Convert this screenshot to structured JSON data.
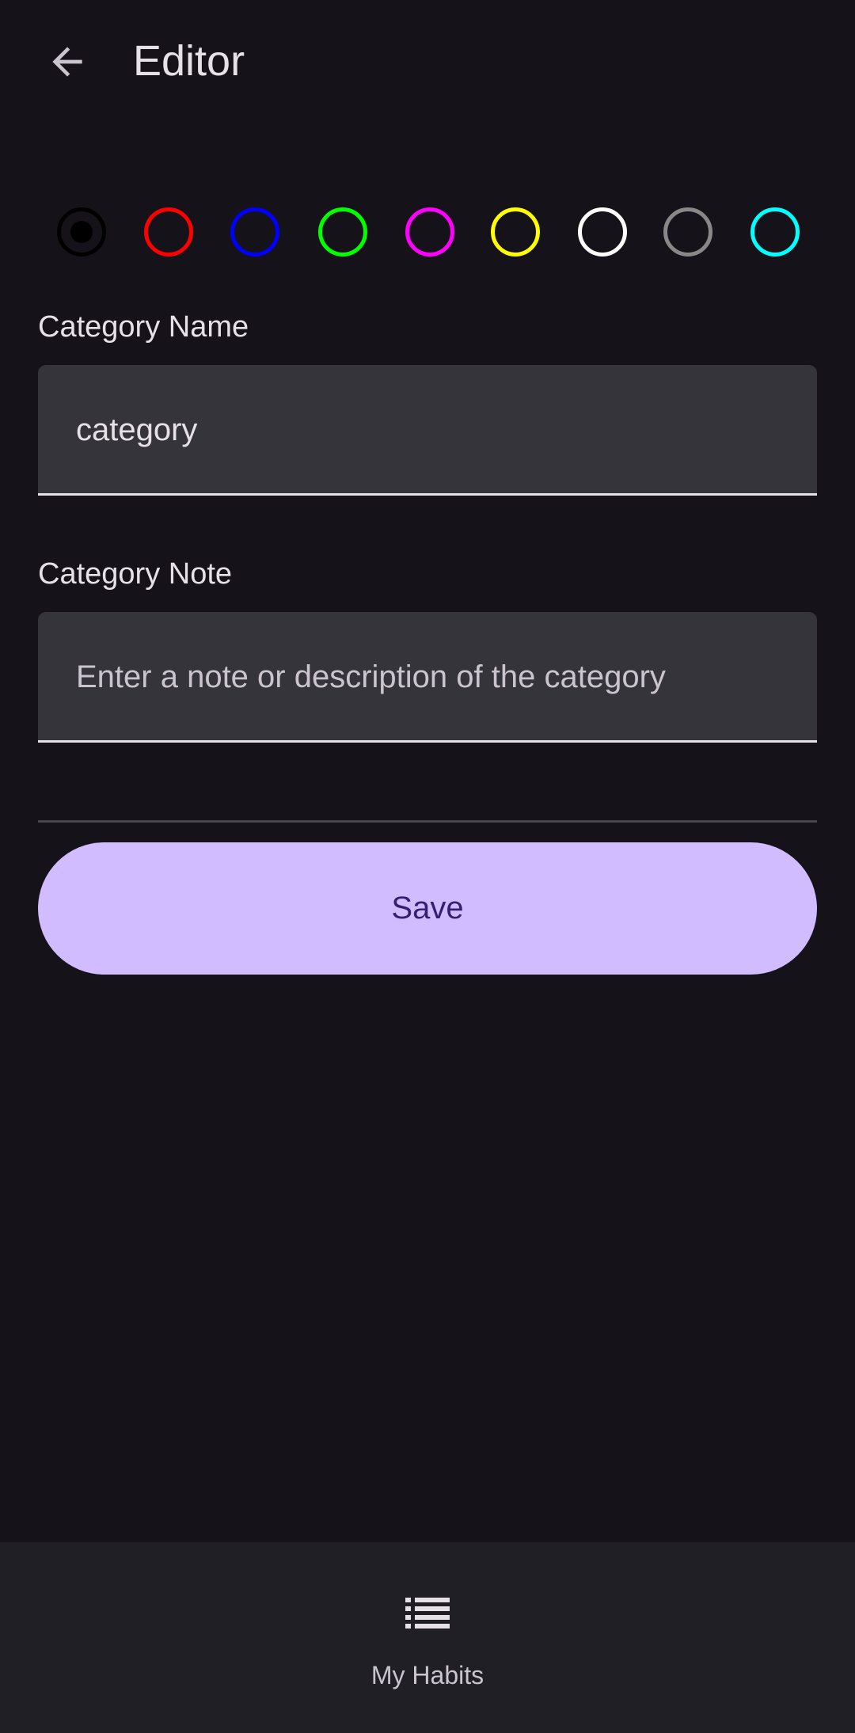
{
  "header": {
    "back_icon": "arrow-left-icon",
    "title": "Editor"
  },
  "color_picker": {
    "selected": "black",
    "colors": [
      {
        "name": "black",
        "hex": "#000000"
      },
      {
        "name": "red",
        "hex": "#ff0000"
      },
      {
        "name": "blue",
        "hex": "#0000ff"
      },
      {
        "name": "green",
        "hex": "#00ff00"
      },
      {
        "name": "magenta",
        "hex": "#ff00ff"
      },
      {
        "name": "yellow",
        "hex": "#ffff00"
      },
      {
        "name": "white",
        "hex": "#ffffff"
      },
      {
        "name": "gray",
        "hex": "#888888"
      },
      {
        "name": "cyan",
        "hex": "#00ffff"
      }
    ]
  },
  "form": {
    "name_label": "Category Name",
    "name_value": "category",
    "note_label": "Category Note",
    "note_placeholder": "Enter a note or description of the category",
    "note_value": ""
  },
  "actions": {
    "save_label": "Save"
  },
  "bottom_nav": {
    "items": [
      {
        "label": "My Habits",
        "icon": "list-icon"
      }
    ]
  },
  "theme": {
    "background": "#151219",
    "surface": "#36343b",
    "accent": "#d0bcff",
    "on_accent": "#381e72"
  }
}
